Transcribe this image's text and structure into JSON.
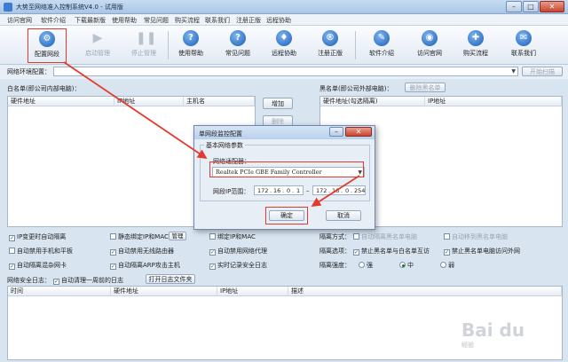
{
  "window": {
    "title": "大势至网络准入控制系统V4.0 - 试用版",
    "minimize": "–",
    "maximize": "□",
    "close": "✕"
  },
  "menu": [
    "访问官网",
    "软件介绍",
    "下载最新版",
    "使用帮助",
    "常见问题",
    "购买流程",
    "联系我们",
    "注册正版",
    "远程协助"
  ],
  "toolbar": [
    {
      "label": "配置网段",
      "glyph": "⚙"
    },
    {
      "label": "启动管理",
      "glyph": "▶"
    },
    {
      "label": "停止管理",
      "glyph": "❚❚"
    },
    {
      "label": "使用帮助",
      "glyph": "?"
    },
    {
      "label": "常见问题",
      "glyph": "?"
    },
    {
      "label": "远程协助",
      "glyph": "♦"
    },
    {
      "label": "注册正版",
      "glyph": "®"
    },
    {
      "label": "软件介绍",
      "glyph": "✎"
    },
    {
      "label": "访问官网",
      "glyph": "◉"
    },
    {
      "label": "购买流程",
      "glyph": "✚"
    },
    {
      "label": "联系我们",
      "glyph": "✉"
    }
  ],
  "net": {
    "label": "网络环境配置：",
    "start": "开始扫描"
  },
  "whitelist": {
    "title": "白名单(即公司内部电脑)：",
    "cols": [
      "硬件地址",
      "IP地址",
      "主机名"
    ]
  },
  "mid_buttons": [
    "增加",
    "删除"
  ],
  "blacklist": {
    "title": "黑名单(即公司外部电脑)：",
    "remove": "删除黑名单",
    "cols": [
      "硬件地址(勾选隔离)",
      "IP地址"
    ]
  },
  "options": {
    "col1": [
      {
        "label": "IP变更时自动隔离",
        "on": true
      },
      {
        "label": "自动禁用手机和平板",
        "on": false
      },
      {
        "label": "自动隔离混杂网卡",
        "on": true
      }
    ],
    "col2": [
      {
        "label": "静态绑定IP和MAC",
        "on": false
      },
      {
        "label": "自动禁用无线路由器",
        "on": true
      },
      {
        "label": "自动隔离ARP攻击主机",
        "on": true
      }
    ],
    "manage": "管理",
    "col3": [
      {
        "label": "绑定IP和MAC",
        "on": false
      },
      {
        "label": "自动禁用网络代理",
        "on": true
      },
      {
        "label": "实时记录安全日志",
        "on": true
      }
    ]
  },
  "isolation": {
    "mode_label": "隔离方式：",
    "mode_opts": [
      {
        "label": "自动隔离黑名单电脑",
        "on": false
      },
      {
        "label": "自动移到黑名单电脑",
        "on": false
      }
    ],
    "opt_label": "隔离选项：",
    "opt_opts": [
      {
        "label": "禁止黑名单与白名单互访",
        "on": true
      },
      {
        "label": "禁止黑名单电脑访问外网",
        "on": true
      }
    ],
    "level_label": "隔离强度：",
    "levels": [
      {
        "label": "强",
        "on": false
      },
      {
        "label": "中",
        "on": true
      },
      {
        "label": "弱",
        "on": false
      }
    ]
  },
  "log": {
    "title": "网络安全日志：",
    "auto_clear": "自动清理一周前的日志",
    "open_folder": "打开日志文件夹",
    "cols": [
      "时间",
      "硬件地址",
      "IP地址",
      "描述"
    ]
  },
  "dialog": {
    "title": "单网段监控配置",
    "group": "基本网络参数",
    "adapter_label": "网络适配器：",
    "adapter_value": "Realtek PCIe GBE Family Controller",
    "ip_label": "网段IP范围：",
    "ip_start": [
      "172",
      "16",
      "0",
      "1"
    ],
    "ip_end": [
      "172",
      "16",
      "0",
      "254"
    ],
    "ok": "确定",
    "cancel": "取消"
  },
  "watermark": {
    "brand": "Bai du",
    "sub": "经验"
  }
}
